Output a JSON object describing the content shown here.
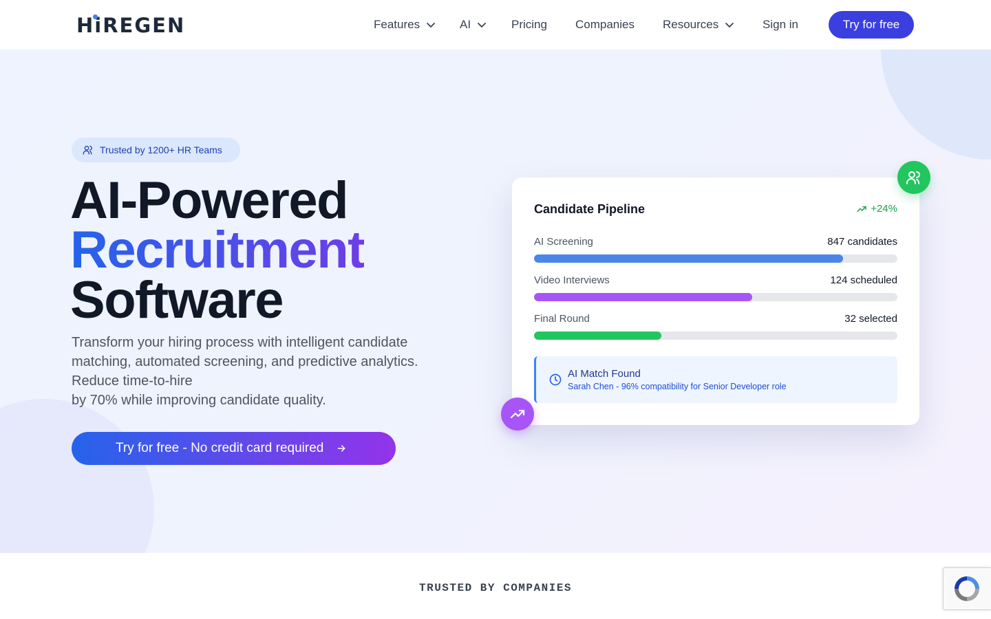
{
  "brand": {
    "logo_text": "HiREGEN"
  },
  "nav": {
    "items": [
      {
        "label": "Features",
        "has_dropdown": true
      },
      {
        "label": "AI",
        "has_dropdown": true
      },
      {
        "label": "Pricing",
        "has_dropdown": false
      },
      {
        "label": "Companies",
        "has_dropdown": false
      },
      {
        "label": "Resources",
        "has_dropdown": true
      },
      {
        "label": "Sign in",
        "has_dropdown": false
      }
    ],
    "cta_label": "Try for free"
  },
  "hero": {
    "badge": "Trusted by 1200+ HR Teams",
    "title_line1": "AI-Powered",
    "title_line2": "Recruitment",
    "title_line3": "Software",
    "description_lines": [
      "Transform your hiring process with intelligent candidate",
      "matching, automated screening, and predictive analytics.",
      "Reduce time-to-hire",
      "by 70% while improving candidate quality."
    ],
    "cta_label": "Try for free - No credit card required"
  },
  "pipeline": {
    "title": "Candidate Pipeline",
    "growth": "+24%",
    "stages": [
      {
        "label": "AI Screening",
        "value": "847 candidates",
        "progress": 0.85,
        "color": "#4a86e8"
      },
      {
        "label": "Video Interviews",
        "value": "124 scheduled",
        "progress": 0.6,
        "color": "#a855f7"
      },
      {
        "label": "Final Round",
        "value": "32 selected",
        "progress": 0.35,
        "color": "#22c55e"
      }
    ],
    "match": {
      "title": "AI Match Found",
      "detail": "Sarah Chen - 96% compatibility for Senior Developer role"
    }
  },
  "trusted": {
    "title": "TRUSTED BY COMPANIES"
  },
  "colors": {
    "primary": "#3b3fe0",
    "gradient_start": "#2563eb",
    "gradient_end": "#9333ea",
    "success": "#22c55e"
  },
  "icons": [
    "users-icon",
    "chevron-down-icon",
    "arrow-right-icon",
    "trending-up-icon",
    "clock-icon",
    "recaptcha-icon"
  ]
}
